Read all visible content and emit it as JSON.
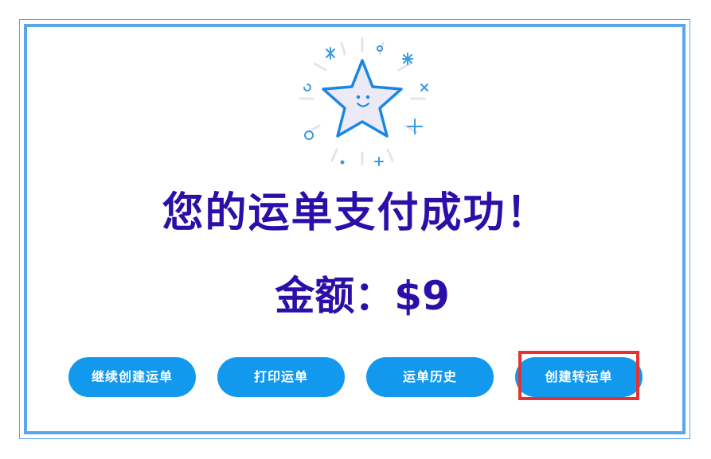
{
  "result": {
    "title": "您的运单支付成功！",
    "amount_text": "金额：$9"
  },
  "actions": {
    "continue_label": "继续创建运单",
    "print_label": "打印运单",
    "history_label": "运单历史",
    "transfer_label": "创建转运单"
  },
  "colors": {
    "frame": "#5aa6e6",
    "heading": "#2b0fa8",
    "button": "#1299ee",
    "highlight": "#e53131"
  },
  "icons": {
    "illustration": "smiling-star-icon"
  }
}
